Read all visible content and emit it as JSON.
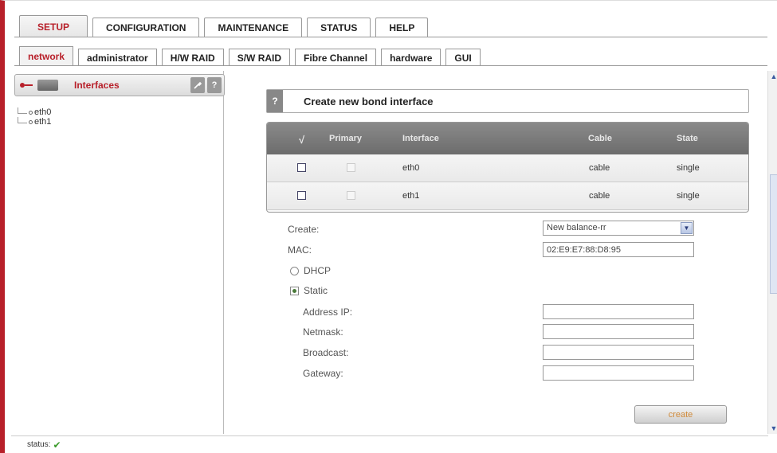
{
  "main_tabs": [
    "SETUP",
    "CONFIGURATION",
    "MAINTENANCE",
    "STATUS",
    "HELP"
  ],
  "sub_tabs": [
    "network",
    "administrator",
    "H/W RAID",
    "S/W RAID",
    "Fibre Channel",
    "hardware",
    "GUI"
  ],
  "left_panel": {
    "title": "Interfaces",
    "tools_icon": "wrench-icon",
    "help_icon": "?",
    "tree": [
      "eth0",
      "eth1"
    ]
  },
  "help_bar": {
    "icon": "?",
    "title": "Create new bond interface"
  },
  "table": {
    "columns": [
      "√",
      "Primary",
      "Interface",
      "Cable",
      "State"
    ],
    "rows": [
      {
        "interface": "eth0",
        "cable": "cable",
        "state": "single"
      },
      {
        "interface": "eth1",
        "cable": "cable",
        "state": "single"
      }
    ]
  },
  "form": {
    "create_label": "Create:",
    "create_value": "New balance-rr",
    "mac_label": "MAC:",
    "mac_value": "02:E9:E7:88:D8:95",
    "dhcp_label": "DHCP",
    "static_label": "Static",
    "address_label": "Address IP:",
    "netmask_label": "Netmask:",
    "broadcast_label": "Broadcast:",
    "gateway_label": "Gateway:",
    "address_value": "",
    "netmask_value": "",
    "broadcast_value": "",
    "gateway_value": "",
    "selected_mode": "Static"
  },
  "create_button": "create",
  "status": {
    "label": "status:",
    "icon": "check-icon"
  },
  "colors": {
    "accent": "#b8202a",
    "table_header": "#7a7a7a",
    "button_text": "#d08a3a"
  }
}
